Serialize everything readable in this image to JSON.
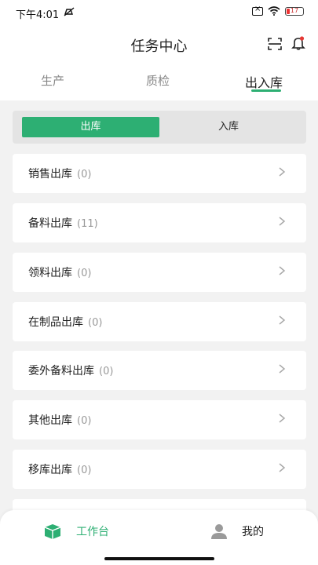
{
  "status_bar": {
    "time": "下午4:01",
    "battery": "17",
    "icons": [
      "no-notify-icon",
      "sim-off-icon",
      "wifi-icon",
      "battery-icon"
    ]
  },
  "header": {
    "title": "任务中心",
    "icons": [
      "scan-icon",
      "bell-icon"
    ],
    "notification_dot_color": "#e53935"
  },
  "tabs": [
    {
      "label": "生产",
      "active": false
    },
    {
      "label": "质检",
      "active": false
    },
    {
      "label": "出入库",
      "active": true
    }
  ],
  "segment": {
    "options": [
      "出库",
      "入库"
    ],
    "selected": "出库"
  },
  "list": [
    {
      "label": "销售出库",
      "count": "(0)"
    },
    {
      "label": "备料出库",
      "count": "(11)"
    },
    {
      "label": "领料出库",
      "count": "(0)"
    },
    {
      "label": "在制品出库",
      "count": "(0)"
    },
    {
      "label": "委外备料出库",
      "count": "(0)"
    },
    {
      "label": "其他出库",
      "count": "(0)"
    },
    {
      "label": "移库出库",
      "count": "(0)"
    }
  ],
  "bottom_nav": [
    {
      "label": "工作台",
      "icon": "workbench-icon",
      "active": true
    },
    {
      "label": "我的",
      "icon": "user-icon",
      "active": false
    }
  ],
  "colors": {
    "accent": "#2daf73",
    "background": "#f2f2f2"
  }
}
